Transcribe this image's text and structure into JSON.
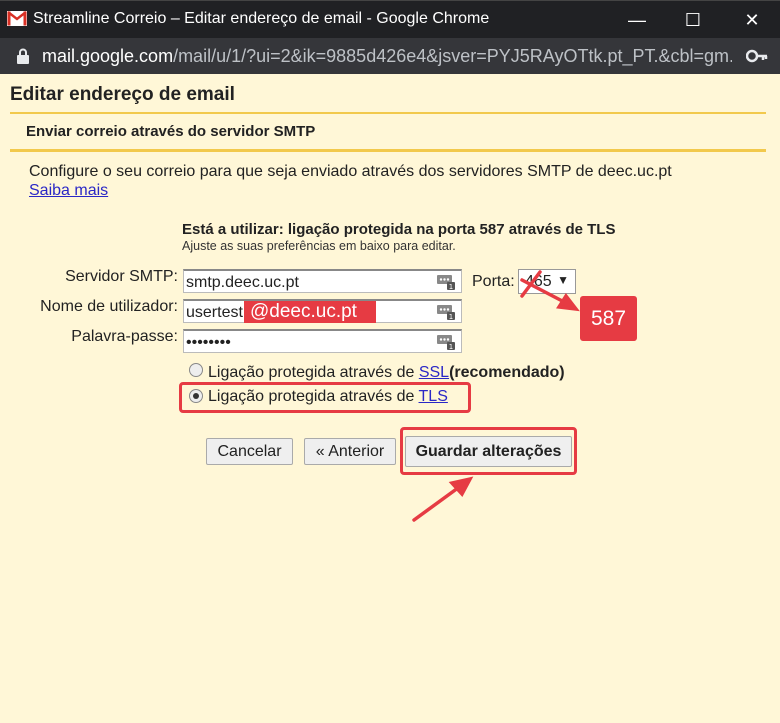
{
  "window": {
    "title": "Streamline Correio – Editar endereço de email - Google Chrome",
    "minimize": "—",
    "maximize": "☐",
    "close": "✕"
  },
  "address": {
    "host": "mail.google.com",
    "path": "/mail/u/1/?ui=2&ik=9885d426e4&jsver=PYJ5RAyOTtk.pt_PT.&cbl=gm..."
  },
  "page": {
    "title": "Editar endereço de email",
    "section_title": "Enviar correio através do servidor SMTP",
    "intro": "Configure o seu correio para que seja enviado através dos servidores SMTP de deec.uc.pt",
    "learn_more": "Saiba mais",
    "using": "Está a utilizar: ligação protegida na porta 587 através de TLS",
    "adjust": "Ajuste as suas preferências em baixo para editar."
  },
  "form": {
    "smtp_label": "Servidor SMTP:",
    "smtp_value": "smtp.deec.uc.pt",
    "user_label": "Nome de utilizador:",
    "user_value": "usertest",
    "user_domain": "@deec.uc.pt",
    "pass_label": "Palavra-passe:",
    "pass_value": "••••••••",
    "port_label": "Porta:",
    "port_value": "465",
    "ssl_prefix": "Ligação protegida através de ",
    "ssl_link": "SSL",
    "ssl_suffix": "(recomendado)",
    "tls_prefix": "Ligação protegida através de ",
    "tls_link": "TLS",
    "selected": "TLS"
  },
  "buttons": {
    "cancel": "Cancelar",
    "previous": "« Anterior",
    "save": "Guardar alterações"
  },
  "annotation": {
    "port_badge": "587",
    "color": "#e63b43"
  }
}
